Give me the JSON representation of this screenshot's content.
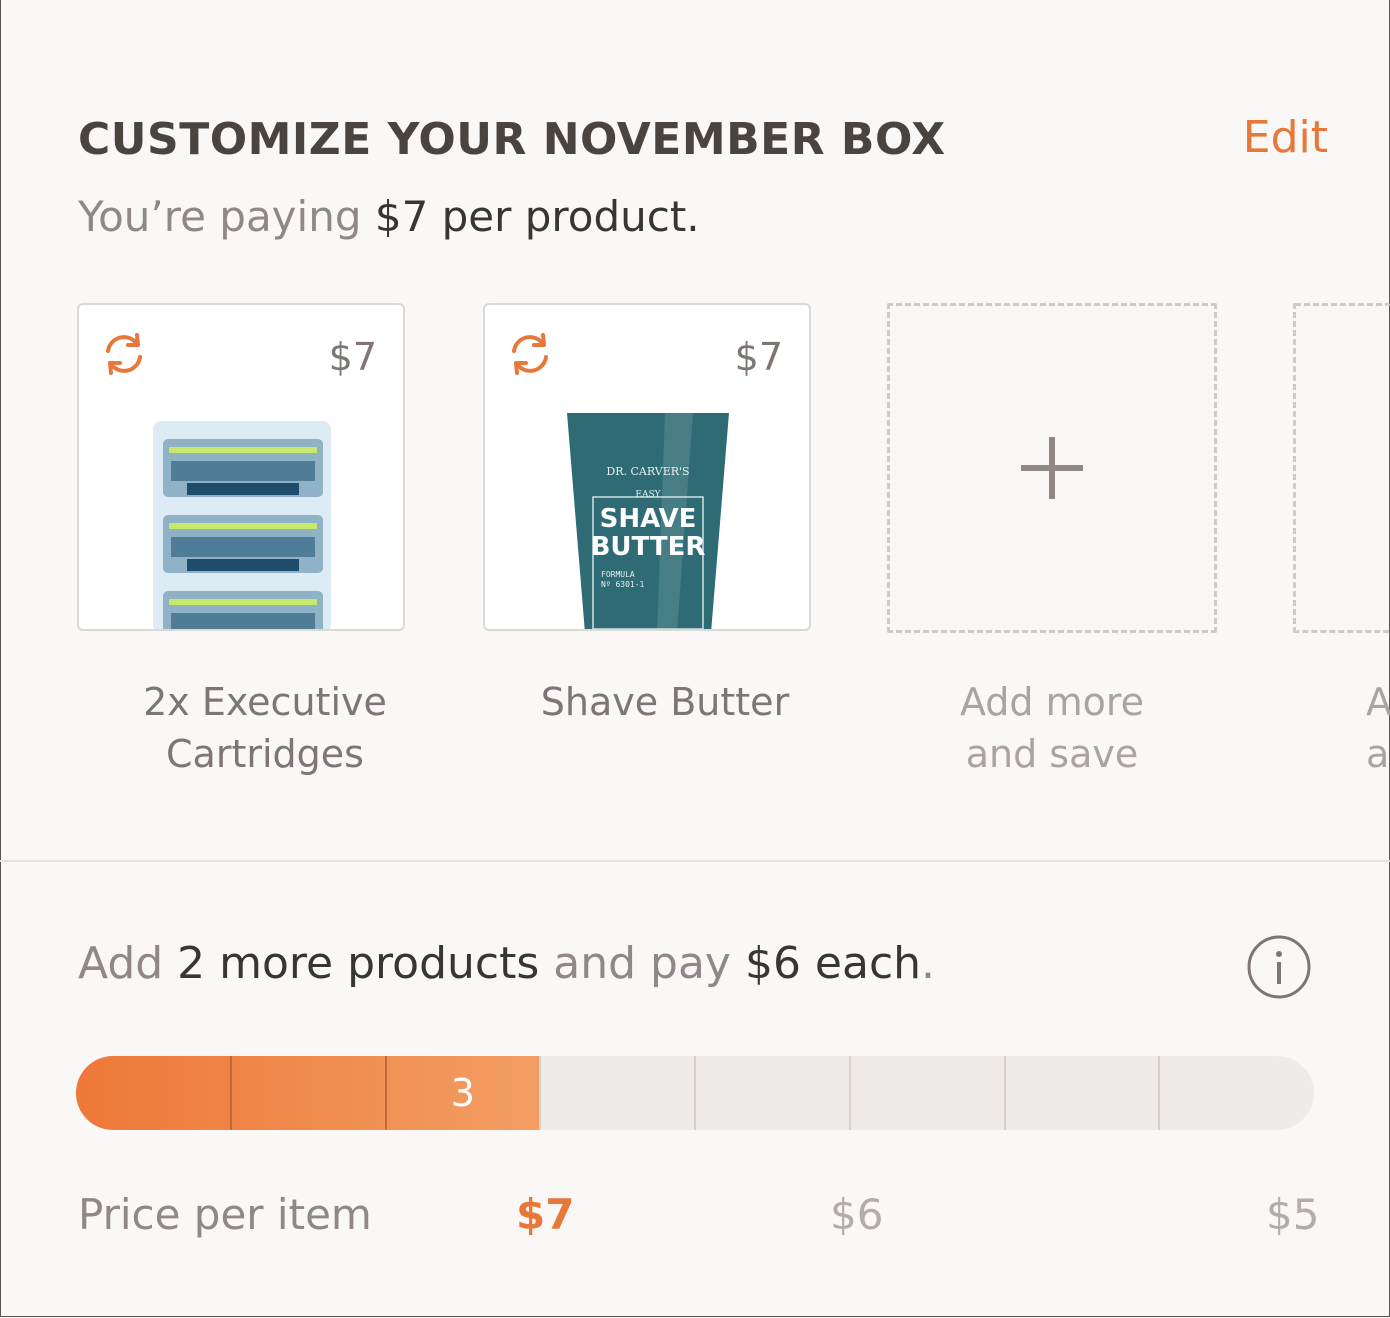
{
  "header": {
    "title": "CUSTOMIZE YOUR NOVEMBER BOX",
    "edit_label": "Edit",
    "subtitle_prefix": "You’re paying ",
    "subtitle_price": "$7",
    "subtitle_suffix": " per product."
  },
  "products": [
    {
      "price": "$7",
      "label_line1": "2x Executive",
      "label_line2": "Cartridges",
      "icon": "refresh-icon"
    },
    {
      "price": "$7",
      "label_line1": "Shave Butter",
      "label_line2": "",
      "icon": "refresh-icon",
      "package_text": {
        "brand": "DR. CARVER'S",
        "line1": "EASY",
        "line2": "SHAVE",
        "line3": "BUTTER",
        "formula": "FORMULA",
        "formula_no": "Nº 6301-1"
      }
    }
  ],
  "add_slots": [
    {
      "label_line1": "Add more",
      "label_line2": "and save",
      "icon": "plus-icon"
    },
    {
      "label_line1": "A",
      "label_line2": "a",
      "icon": "plus-icon"
    }
  ],
  "upsell": {
    "prefix": "Add ",
    "count": "2 more products",
    "middle": " and pay ",
    "price": "$6 each",
    "suffix": "."
  },
  "progress": {
    "filled_segments": 3,
    "total_segments": 8,
    "current_label": "3",
    "fill_fraction": 0.375
  },
  "price_tiers": {
    "label": "Price per item",
    "tiers": [
      "$7",
      "$6",
      "$5"
    ],
    "active_index": 0
  },
  "colors": {
    "accent": "#e8773a",
    "bar_empty": "#efebe8",
    "tube": "#2e6b74"
  }
}
